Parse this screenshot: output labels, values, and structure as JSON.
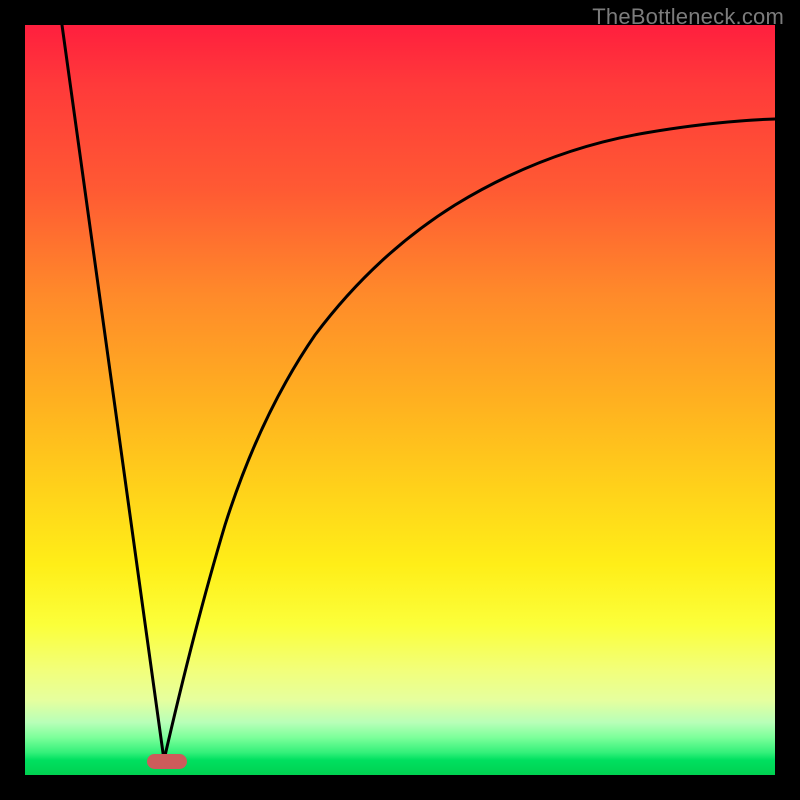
{
  "watermark": "TheBottleneck.com",
  "chart_data": {
    "type": "line",
    "title": "",
    "xlabel": "",
    "ylabel": "",
    "xlim": [
      0,
      100
    ],
    "ylim": [
      0,
      100
    ],
    "grid": false,
    "background_gradient": {
      "top": "#ff1f3e",
      "mid": "#ffd21a",
      "bottom": "#00d050",
      "notes": "vertical gradient red→yellow→green; green only in bottom ~3% band"
    },
    "series": [
      {
        "name": "left-descending-line",
        "color": "#000000",
        "type": "line",
        "x": [
          5,
          18.5
        ],
        "values": [
          100,
          2
        ],
        "notes": "straight descent from top-left to the cusp"
      },
      {
        "name": "right-ascending-curve",
        "color": "#000000",
        "type": "line",
        "x": [
          18.5,
          25,
          33,
          42,
          55,
          70,
          85,
          100
        ],
        "values": [
          2,
          30,
          50,
          62,
          72,
          79,
          83,
          86
        ],
        "notes": "monotone concave curve rising from cusp toward upper right, flattening out"
      }
    ],
    "marker": {
      "name": "cusp-lozenge",
      "color": "#cd5b5b",
      "shape": "rounded-rect",
      "center_x": 19,
      "center_y": 2,
      "width_pct": 5,
      "height_pct": 2
    }
  }
}
